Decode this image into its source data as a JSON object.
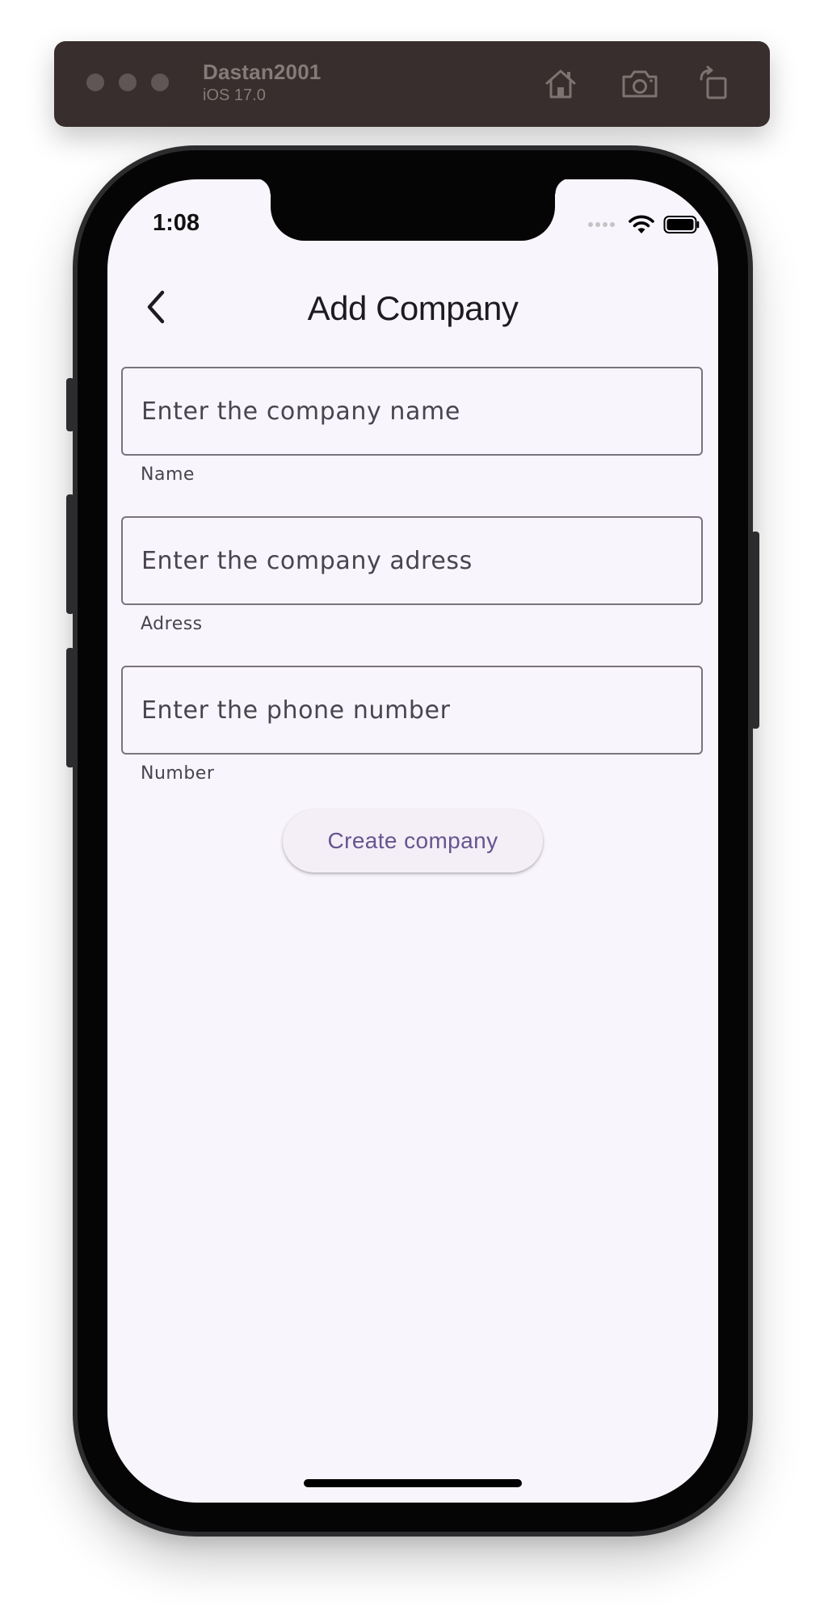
{
  "simulator": {
    "device_name": "Dastan2001",
    "os_version": "iOS 17.0",
    "icons": [
      "home-icon",
      "camera-icon",
      "rotate-icon"
    ]
  },
  "status_bar": {
    "time": "1:08",
    "icons": [
      "cellular-icon",
      "wifi-icon",
      "battery-icon"
    ]
  },
  "app_bar": {
    "back_icon": "chevron-left-icon",
    "title": "Add Company"
  },
  "form": {
    "name": {
      "placeholder": "Enter the company name",
      "helper": "Name",
      "value": ""
    },
    "address": {
      "placeholder": "Enter the company adress",
      "helper": "Adress",
      "value": ""
    },
    "phone": {
      "placeholder": "Enter the phone number",
      "helper": "Number",
      "value": ""
    },
    "submit_label": "Create company"
  },
  "colors": {
    "background": "#f9f5fc",
    "outline": "#79747e",
    "text": "#1d1b20",
    "secondary_text": "#49454f",
    "button_background": "#f4eff7",
    "button_text": "#65558f",
    "simulator_bar": "#372e2d"
  }
}
